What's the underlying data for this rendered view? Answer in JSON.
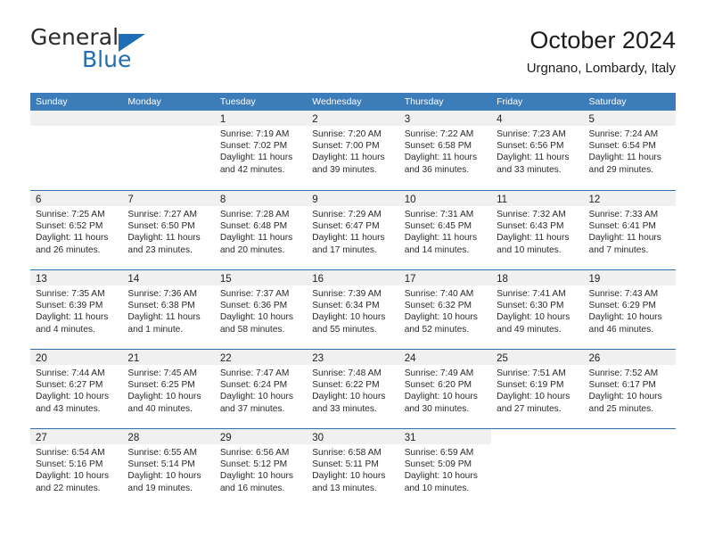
{
  "brand": {
    "name_part1": "General",
    "name_part2": "Blue",
    "accent_color": "#1f6db5"
  },
  "header": {
    "title": "October 2024",
    "subtitle": "Urgnano, Lombardy, Italy"
  },
  "colors": {
    "header_blue": "#3b7cb9",
    "row_rule_blue": "#2f6fad",
    "day_band_gray": "#f0f0f0"
  },
  "weekdays": [
    "Sunday",
    "Monday",
    "Tuesday",
    "Wednesday",
    "Thursday",
    "Friday",
    "Saturday"
  ],
  "weeks": [
    [
      {
        "day": "",
        "empty": true
      },
      {
        "day": "",
        "empty": true
      },
      {
        "day": "1",
        "sunrise": "Sunrise: 7:19 AM",
        "sunset": "Sunset: 7:02 PM",
        "daylight1": "Daylight: 11 hours",
        "daylight2": "and 42 minutes."
      },
      {
        "day": "2",
        "sunrise": "Sunrise: 7:20 AM",
        "sunset": "Sunset: 7:00 PM",
        "daylight1": "Daylight: 11 hours",
        "daylight2": "and 39 minutes."
      },
      {
        "day": "3",
        "sunrise": "Sunrise: 7:22 AM",
        "sunset": "Sunset: 6:58 PM",
        "daylight1": "Daylight: 11 hours",
        "daylight2": "and 36 minutes."
      },
      {
        "day": "4",
        "sunrise": "Sunrise: 7:23 AM",
        "sunset": "Sunset: 6:56 PM",
        "daylight1": "Daylight: 11 hours",
        "daylight2": "and 33 minutes."
      },
      {
        "day": "5",
        "sunrise": "Sunrise: 7:24 AM",
        "sunset": "Sunset: 6:54 PM",
        "daylight1": "Daylight: 11 hours",
        "daylight2": "and 29 minutes."
      }
    ],
    [
      {
        "day": "6",
        "sunrise": "Sunrise: 7:25 AM",
        "sunset": "Sunset: 6:52 PM",
        "daylight1": "Daylight: 11 hours",
        "daylight2": "and 26 minutes."
      },
      {
        "day": "7",
        "sunrise": "Sunrise: 7:27 AM",
        "sunset": "Sunset: 6:50 PM",
        "daylight1": "Daylight: 11 hours",
        "daylight2": "and 23 minutes."
      },
      {
        "day": "8",
        "sunrise": "Sunrise: 7:28 AM",
        "sunset": "Sunset: 6:48 PM",
        "daylight1": "Daylight: 11 hours",
        "daylight2": "and 20 minutes."
      },
      {
        "day": "9",
        "sunrise": "Sunrise: 7:29 AM",
        "sunset": "Sunset: 6:47 PM",
        "daylight1": "Daylight: 11 hours",
        "daylight2": "and 17 minutes."
      },
      {
        "day": "10",
        "sunrise": "Sunrise: 7:31 AM",
        "sunset": "Sunset: 6:45 PM",
        "daylight1": "Daylight: 11 hours",
        "daylight2": "and 14 minutes."
      },
      {
        "day": "11",
        "sunrise": "Sunrise: 7:32 AM",
        "sunset": "Sunset: 6:43 PM",
        "daylight1": "Daylight: 11 hours",
        "daylight2": "and 10 minutes."
      },
      {
        "day": "12",
        "sunrise": "Sunrise: 7:33 AM",
        "sunset": "Sunset: 6:41 PM",
        "daylight1": "Daylight: 11 hours",
        "daylight2": "and 7 minutes."
      }
    ],
    [
      {
        "day": "13",
        "sunrise": "Sunrise: 7:35 AM",
        "sunset": "Sunset: 6:39 PM",
        "daylight1": "Daylight: 11 hours",
        "daylight2": "and 4 minutes."
      },
      {
        "day": "14",
        "sunrise": "Sunrise: 7:36 AM",
        "sunset": "Sunset: 6:38 PM",
        "daylight1": "Daylight: 11 hours",
        "daylight2": "and 1 minute."
      },
      {
        "day": "15",
        "sunrise": "Sunrise: 7:37 AM",
        "sunset": "Sunset: 6:36 PM",
        "daylight1": "Daylight: 10 hours",
        "daylight2": "and 58 minutes."
      },
      {
        "day": "16",
        "sunrise": "Sunrise: 7:39 AM",
        "sunset": "Sunset: 6:34 PM",
        "daylight1": "Daylight: 10 hours",
        "daylight2": "and 55 minutes."
      },
      {
        "day": "17",
        "sunrise": "Sunrise: 7:40 AM",
        "sunset": "Sunset: 6:32 PM",
        "daylight1": "Daylight: 10 hours",
        "daylight2": "and 52 minutes."
      },
      {
        "day": "18",
        "sunrise": "Sunrise: 7:41 AM",
        "sunset": "Sunset: 6:30 PM",
        "daylight1": "Daylight: 10 hours",
        "daylight2": "and 49 minutes."
      },
      {
        "day": "19",
        "sunrise": "Sunrise: 7:43 AM",
        "sunset": "Sunset: 6:29 PM",
        "daylight1": "Daylight: 10 hours",
        "daylight2": "and 46 minutes."
      }
    ],
    [
      {
        "day": "20",
        "sunrise": "Sunrise: 7:44 AM",
        "sunset": "Sunset: 6:27 PM",
        "daylight1": "Daylight: 10 hours",
        "daylight2": "and 43 minutes."
      },
      {
        "day": "21",
        "sunrise": "Sunrise: 7:45 AM",
        "sunset": "Sunset: 6:25 PM",
        "daylight1": "Daylight: 10 hours",
        "daylight2": "and 40 minutes."
      },
      {
        "day": "22",
        "sunrise": "Sunrise: 7:47 AM",
        "sunset": "Sunset: 6:24 PM",
        "daylight1": "Daylight: 10 hours",
        "daylight2": "and 37 minutes."
      },
      {
        "day": "23",
        "sunrise": "Sunrise: 7:48 AM",
        "sunset": "Sunset: 6:22 PM",
        "daylight1": "Daylight: 10 hours",
        "daylight2": "and 33 minutes."
      },
      {
        "day": "24",
        "sunrise": "Sunrise: 7:49 AM",
        "sunset": "Sunset: 6:20 PM",
        "daylight1": "Daylight: 10 hours",
        "daylight2": "and 30 minutes."
      },
      {
        "day": "25",
        "sunrise": "Sunrise: 7:51 AM",
        "sunset": "Sunset: 6:19 PM",
        "daylight1": "Daylight: 10 hours",
        "daylight2": "and 27 minutes."
      },
      {
        "day": "26",
        "sunrise": "Sunrise: 7:52 AM",
        "sunset": "Sunset: 6:17 PM",
        "daylight1": "Daylight: 10 hours",
        "daylight2": "and 25 minutes."
      }
    ],
    [
      {
        "day": "27",
        "sunrise": "Sunrise: 6:54 AM",
        "sunset": "Sunset: 5:16 PM",
        "daylight1": "Daylight: 10 hours",
        "daylight2": "and 22 minutes."
      },
      {
        "day": "28",
        "sunrise": "Sunrise: 6:55 AM",
        "sunset": "Sunset: 5:14 PM",
        "daylight1": "Daylight: 10 hours",
        "daylight2": "and 19 minutes."
      },
      {
        "day": "29",
        "sunrise": "Sunrise: 6:56 AM",
        "sunset": "Sunset: 5:12 PM",
        "daylight1": "Daylight: 10 hours",
        "daylight2": "and 16 minutes."
      },
      {
        "day": "30",
        "sunrise": "Sunrise: 6:58 AM",
        "sunset": "Sunset: 5:11 PM",
        "daylight1": "Daylight: 10 hours",
        "daylight2": "and 13 minutes."
      },
      {
        "day": "31",
        "sunrise": "Sunrise: 6:59 AM",
        "sunset": "Sunset: 5:09 PM",
        "daylight1": "Daylight: 10 hours",
        "daylight2": "and 10 minutes."
      },
      {
        "day": "",
        "empty": true,
        "blank_band": true
      },
      {
        "day": "",
        "empty": true,
        "blank_band": true
      }
    ]
  ]
}
